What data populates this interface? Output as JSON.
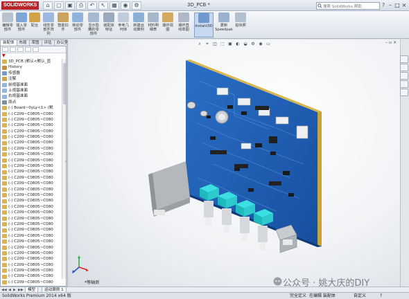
{
  "app": {
    "logo_text": "SOLIDWORKS",
    "document_title": "3D_PCB *",
    "search_placeholder": "搜索 SolidWorks 帮助",
    "help_label": "?",
    "win_min": "–",
    "win_max": "□",
    "win_close": "×"
  },
  "quick_access": [
    "⌂",
    "▢",
    "▣",
    "⎙",
    "↶",
    "↖",
    "▦",
    "◉",
    "⚙"
  ],
  "ribbon": {
    "commands": [
      {
        "label": "编辑零\n部件",
        "color": "#b9c2cf"
      },
      {
        "label": "插入零\n部件",
        "color": "#7fa6d6"
      },
      {
        "label": "配合",
        "color": "#d0a24a"
      },
      {
        "label": "线性零\n部件阵\n列",
        "color": "#9cb8de"
      },
      {
        "label": "智能扣\n件",
        "color": "#c9a35f"
      },
      {
        "label": "移动零\n部件",
        "color": "#8fb3dd"
      },
      {
        "label": "显示隐\n藏的零\n部件",
        "color": "#a6b9d0"
      },
      {
        "label": "装配体\n特征",
        "color": "#9aa9bd"
      },
      {
        "label": "参考几\n何体",
        "color": "#c0ccdb"
      },
      {
        "label": "新建运\n动算例",
        "color": "#8ab0d8"
      },
      {
        "label": "材料明\n细表",
        "color": "#a7b6c9"
      },
      {
        "label": "爆炸视\n图",
        "color": "#d2a95e"
      },
      {
        "label": "爆炸直\n线草图",
        "color": "#aeb8c6"
      },
      {
        "label": "Instant3D",
        "color": "#6f98cf"
      },
      {
        "label": "更新\nSpeedpak",
        "color": "#9ab2cf"
      },
      {
        "label": "拍快照",
        "color": "#b4bfcd"
      }
    ]
  },
  "panel_tabs": [
    "装配体",
    "布局",
    "草图",
    "评估",
    "办公室产品"
  ],
  "tree": {
    "filter_symbol": "▼",
    "items": [
      {
        "label": "3D_PCB (默认<默认_显",
        "color": "#d8b24c"
      },
      {
        "label": "History",
        "color": "#c98a3a"
      },
      {
        "label": "传感器",
        "color": "#6f9bd1"
      },
      {
        "label": "注解",
        "color": "#d2a44a"
      },
      {
        "label": "前视基准面",
        "color": "#8fb7de"
      },
      {
        "label": "上视基准面",
        "color": "#8fb7de"
      },
      {
        "label": "右视基准面",
        "color": "#8fb7de"
      },
      {
        "label": "原点",
        "color": "#7e8ea3"
      },
      {
        "label": "(-) Board~0yLy<1> (默",
        "color": "#e0b14a"
      },
      {
        "label": "(-) C209~C0805~C080",
        "color": "#e0b14a"
      },
      {
        "label": "(-) C209~C0805~C080",
        "color": "#e0b14a"
      },
      {
        "label": "(-) C209~C0805~C080",
        "color": "#e0b14a"
      },
      {
        "label": "(-) C209~C0805~C080",
        "color": "#e0b14a"
      },
      {
        "label": "(-) C209~C0805~C080",
        "color": "#e0b14a"
      },
      {
        "label": "(-) C209~C0805~C080",
        "color": "#e0b14a"
      },
      {
        "label": "(-) C209~C0805~C080",
        "color": "#e0b14a"
      },
      {
        "label": "(-) C209~C0805~C080",
        "color": "#e0b14a"
      },
      {
        "label": "(-) C209~C0805~C080",
        "color": "#e0b14a"
      },
      {
        "label": "(-) C209~C0805~C080",
        "color": "#e0b14a"
      },
      {
        "label": "(-) C209~C0805~C080",
        "color": "#e0b14a"
      },
      {
        "label": "(-) C209~C0805~C080",
        "color": "#e0b14a"
      },
      {
        "label": "(-) C209~C0805~C080",
        "color": "#e0b14a"
      },
      {
        "label": "(-) C209~C0805~C080",
        "color": "#e0b14a"
      },
      {
        "label": "(-) C209~C0805~C080",
        "color": "#e0b14a"
      },
      {
        "label": "(-) C209~C0805~C080",
        "color": "#e0b14a"
      },
      {
        "label": "(-) C209~C0805~C080",
        "color": "#e0b14a"
      },
      {
        "label": "(-) C209~C0805~C080",
        "color": "#e0b14a"
      },
      {
        "label": "(-) C209~C0805~C080",
        "color": "#e0b14a"
      },
      {
        "label": "(-) C209~C0805~C080",
        "color": "#e0b14a"
      },
      {
        "label": "(-) C209~C0805~C080",
        "color": "#e0b14a"
      },
      {
        "label": "(-) C209~C0805~C080",
        "color": "#e0b14a"
      },
      {
        "label": "(-) C209~C0805~C080",
        "color": "#e0b14a"
      },
      {
        "label": "(-) C209~C0805~C080",
        "color": "#e0b14a"
      },
      {
        "label": "(-) C209~C0805~C080",
        "color": "#e0b14a"
      },
      {
        "label": "(-) C209~C0805~C080",
        "color": "#e0b14a"
      },
      {
        "label": "(-) C209~C0805~C080",
        "color": "#e0b14a"
      },
      {
        "label": "(-) C209~C0805~C080",
        "color": "#e0b14a"
      },
      {
        "label": "(-) C209~C0805~C080",
        "color": "#e0b14a"
      },
      {
        "label": "(-) C209~C0805~C080",
        "color": "#e0b14a"
      },
      {
        "label": "(-) C209~C0805~C080",
        "color": "#e0b14a"
      },
      {
        "label": "(-) C209~C0805~C080",
        "color": "#e0b14a"
      }
    ]
  },
  "viewport": {
    "view_label": "*等轴测",
    "heads_up": [
      "⌕",
      "⌖",
      "◫",
      "⬚",
      "▣",
      "◐",
      "◒",
      "⚙",
      "◉",
      "▭"
    ]
  },
  "model_tabs": [
    "模型",
    "运动算例 1"
  ],
  "status": {
    "left": "SolidWorks Premium 2014 x64 版",
    "fully_defined": "完全定义",
    "editing": "在编辑 装配体",
    "custom": "自定义",
    "help": "?"
  },
  "watermark": "公众号 · 姚大庆的DIY",
  "colors": {
    "pcb_blue": "#1f5fb5",
    "knob_cyan": "#2fd3d6",
    "accent": "#b8262b"
  }
}
